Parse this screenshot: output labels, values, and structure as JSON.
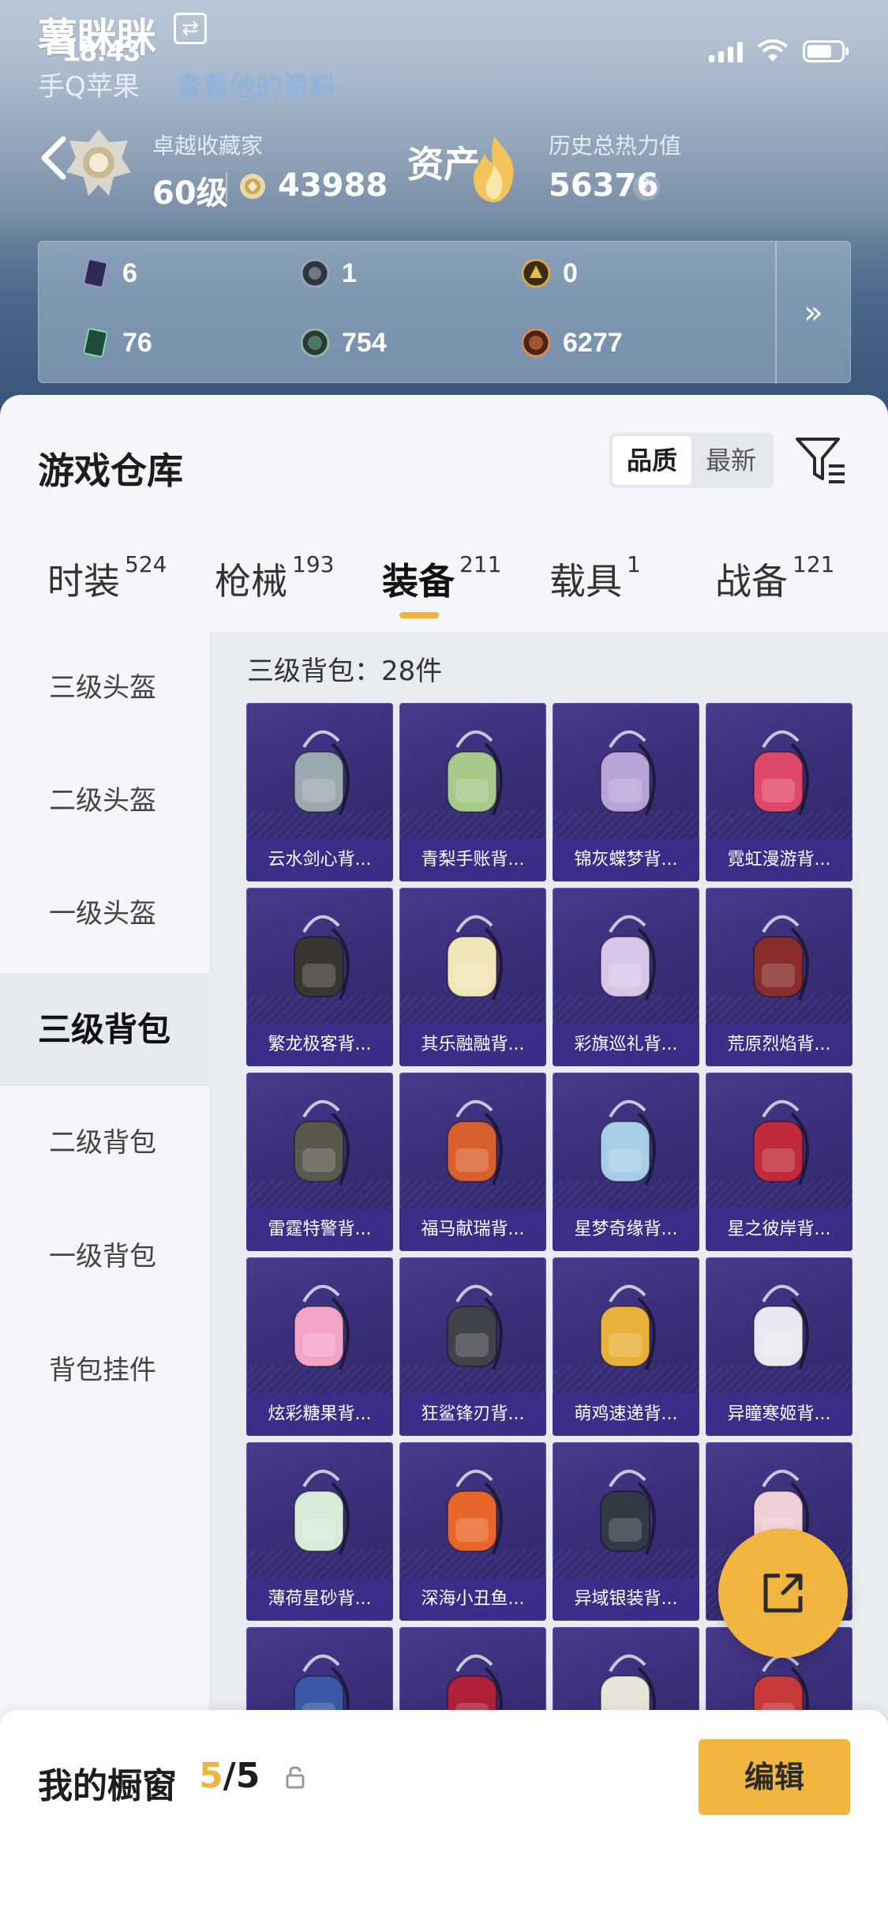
{
  "status_bar": {
    "time": "18:43"
  },
  "profile": {
    "name": "薯眯眯",
    "platform": "手Q苹果",
    "platform_link": "查看他的资料",
    "collector_title": "卓越收藏家",
    "level": "60级",
    "coins": "43988",
    "assets_label": "资产",
    "heat_title": "历史总热力值",
    "heat_value": "56376",
    "help": "?"
  },
  "stats": [
    {
      "icon": "card-icon",
      "value": "6",
      "color": "#3e3a6a"
    },
    {
      "icon": "ring-icon",
      "value": "1",
      "color": "#3a4350"
    },
    {
      "icon": "gold-coin-icon",
      "value": "0",
      "color": "#5a4520"
    },
    {
      "icon": "green-card-icon",
      "value": "76",
      "color": "#2f5a4a"
    },
    {
      "icon": "green-orb-icon",
      "value": "754",
      "color": "#3c5248"
    },
    {
      "icon": "bronze-orb-icon",
      "value": "6277",
      "color": "#6a3a25"
    }
  ],
  "stats_more": "»",
  "warehouse": {
    "title": "游戏仓库",
    "sort_options": [
      "品质",
      "最新"
    ],
    "active_sort": "品质",
    "tabs": [
      {
        "label": "时装",
        "count": "524"
      },
      {
        "label": "枪械",
        "count": "193"
      },
      {
        "label": "装备",
        "count": "211"
      },
      {
        "label": "载具",
        "count": "1"
      },
      {
        "label": "战备",
        "count": "121"
      }
    ],
    "active_tab": "装备",
    "sidebar": [
      "三级头盔",
      "二级头盔",
      "一级头盔",
      "三级背包",
      "二级背包",
      "一级背包",
      "背包挂件"
    ],
    "active_sidebar": "三级背包",
    "count_label": "三级背包：28件",
    "items": [
      "云水剑心背...",
      "青梨手账背...",
      "锦灰蝶梦背...",
      "霓虹漫游背...",
      "繁龙极客背...",
      "其乐融融背...",
      "彩旗巡礼背...",
      "荒原烈焰背...",
      "雷霆特警背...",
      "福马献瑞背...",
      "星梦奇缘背...",
      "星之彼岸背...",
      "炫彩糖果背...",
      "狂鲨锋刃背...",
      "萌鸡速递背...",
      "异瞳寒姬背...",
      "薄荷星砂背...",
      "深海小丑鱼...",
      "异域银装背...",
      "",
      "",
      "",
      "",
      ""
    ],
    "item_colors": [
      "#9aa9b0",
      "#a7c98a",
      "#b9a3d8",
      "#e0486a",
      "#3a3530",
      "#f1e6b8",
      "#d8c6e8",
      "#8a2d2d",
      "#5a574c",
      "#d8602e",
      "#a8cde8",
      "#c02a3a",
      "#f2a4c8",
      "#40434a",
      "#e8b23a",
      "#e8e8f0",
      "#d6ecd8",
      "#e8662a",
      "#2f3a44",
      "#f0d0d8",
      "#3a5aa8",
      "#b0203a",
      "#e8e4d8",
      "#c83a3a"
    ]
  },
  "showcase": {
    "label": "我的橱窗",
    "current": "5",
    "separator": "/",
    "max": "5"
  },
  "edit_button": "编辑"
}
